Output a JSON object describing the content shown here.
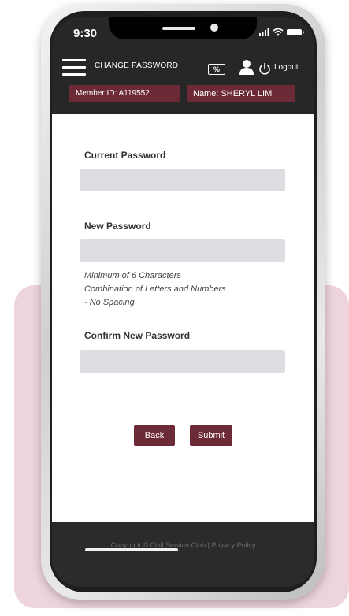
{
  "status_bar": {
    "time": "9:30",
    "icons": [
      "signal-icon",
      "wifi-icon",
      "battery-icon"
    ]
  },
  "app_bar": {
    "menu_icon": "hamburger-menu-icon",
    "title": "CHANGE PASSWORD",
    "discount_icon": "percent-card-icon",
    "discount_label": "%",
    "user_icon": "user-icon",
    "power_icon": "power-icon",
    "logout_label": "Logout"
  },
  "member": {
    "id_text": "Member ID: A119552",
    "name_text": "Name: SHERYL LIM"
  },
  "form": {
    "current_password_label": "Current Password",
    "current_password_value": "",
    "new_password_label": "New Password",
    "new_password_value": "",
    "hints": [
      "Minimum of 6 Characters",
      "Combination of Letters and Numbers",
      "- No Spacing"
    ],
    "confirm_password_label": "Confirm New Password",
    "confirm_password_value": "",
    "back_label": "Back",
    "submit_label": "Submit"
  },
  "footer": {
    "copyright": "Copyright © Civil Service Club",
    "separator": "|",
    "privacy_link": "Privacy Policy"
  },
  "colors": {
    "accent": "#6b2a35",
    "header_bg": "#272727",
    "field_bg": "#dcdee2",
    "background_card": "#eed5dc"
  }
}
